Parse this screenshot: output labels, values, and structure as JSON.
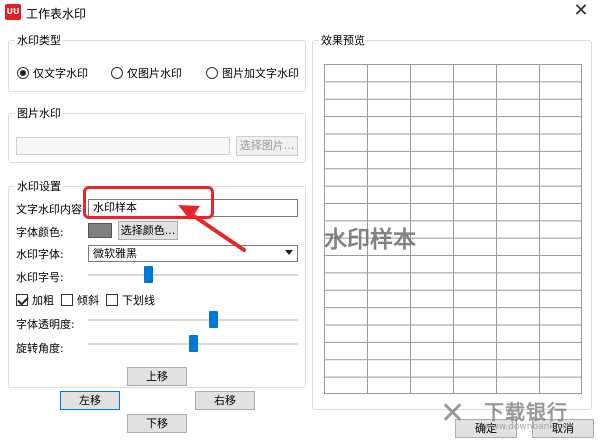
{
  "window": {
    "title": "工作表水印",
    "icon_text": "UU",
    "close_glyph": "✕"
  },
  "type_group": {
    "legend": "水印类型",
    "options": [
      {
        "label": "仅文字水印",
        "selected": true
      },
      {
        "label": "仅图片水印",
        "selected": false
      },
      {
        "label": "图片加文字水印",
        "selected": false
      }
    ]
  },
  "image_group": {
    "legend": "图片水印",
    "path_value": "",
    "select_button": "选择图片..."
  },
  "settings_group": {
    "legend": "水印设置",
    "content_label": "文字水印内容:",
    "content_value": "水印样本",
    "color_label": "字体颜色:",
    "color_value": "#808080",
    "color_button": "选择颜色...",
    "font_label": "水印字体:",
    "font_value": "微软雅黑",
    "size_label": "水印字号:",
    "size_level": 0.28,
    "bold_label": "加粗",
    "bold_checked": true,
    "italic_label": "倾斜",
    "italic_checked": false,
    "underline_label": "下划线",
    "underline_checked": false,
    "opacity_label": "字体透明度:",
    "opacity_level": 0.6,
    "rotation_label": "旋转角度:",
    "rotation_level": 0.5
  },
  "move_buttons": {
    "up": "上移",
    "left": "左移",
    "right": "右移",
    "down": "下移"
  },
  "preview": {
    "legend": "效果预览",
    "watermark_text": "水印样本"
  },
  "footer": {
    "ok": "确定",
    "cancel": "取消"
  },
  "brand": {
    "name": "下载银行",
    "url": "www.downbank.cn"
  },
  "colors": {
    "accent": "#0078d7",
    "highlight": "#e8242d",
    "icon_red": "#e21f26"
  }
}
